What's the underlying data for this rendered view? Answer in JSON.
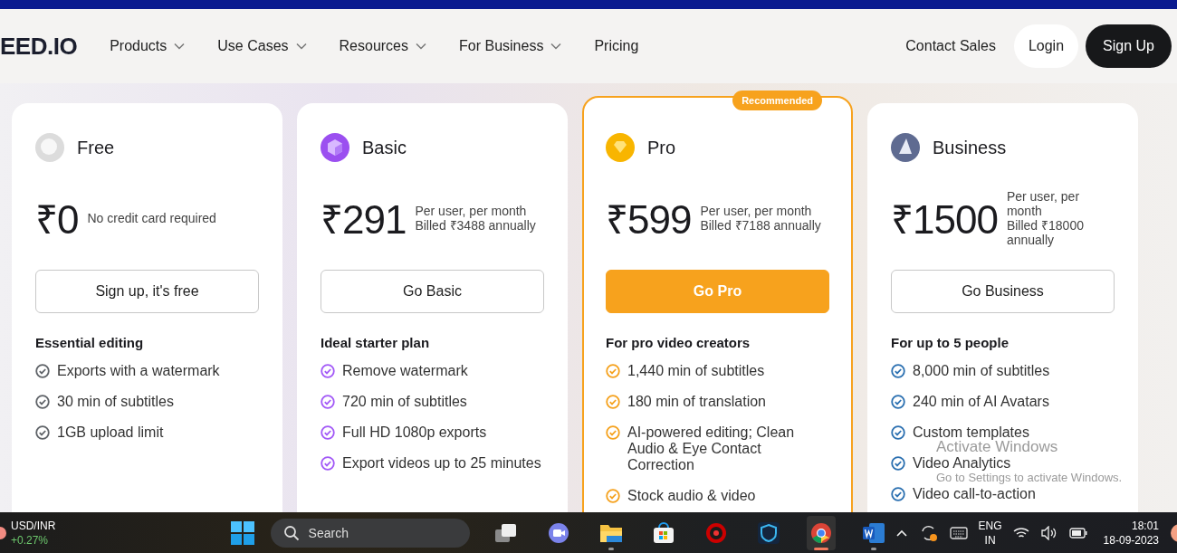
{
  "header": {
    "logo": "EED.IO",
    "nav": [
      {
        "label": "Products",
        "dropdown": true
      },
      {
        "label": "Use Cases",
        "dropdown": true
      },
      {
        "label": "Resources",
        "dropdown": true
      },
      {
        "label": "For Business",
        "dropdown": true
      },
      {
        "label": "Pricing",
        "dropdown": false
      }
    ],
    "contact": "Contact Sales",
    "login": "Login",
    "signup": "Sign Up"
  },
  "plans": [
    {
      "kind": "free",
      "name": "Free",
      "price": "₹0",
      "note": [
        "No credit card required"
      ],
      "button": "Sign up, it's free",
      "highlighted": false,
      "color": "#5f6368",
      "heading": "Essential editing",
      "features": [
        "Exports with a watermark",
        "30 min of subtitles",
        "1GB upload limit"
      ]
    },
    {
      "kind": "basic",
      "name": "Basic",
      "price": "₹291",
      "note": [
        "Per user, per month",
        "Billed ₹3488 annually"
      ],
      "button": "Go Basic",
      "highlighted": false,
      "color": "#a259f7",
      "heading": "Ideal starter plan",
      "features": [
        "Remove watermark",
        "720 min of subtitles",
        "Full HD 1080p exports",
        "Export videos up to 25 minutes"
      ]
    },
    {
      "kind": "pro",
      "name": "Pro",
      "badge": "Recommended",
      "price": "₹599",
      "note": [
        "Per user, per month",
        "Billed ₹7188 annually"
      ],
      "button": "Go Pro",
      "highlighted": true,
      "color": "#f5a11c",
      "heading": "For pro video creators",
      "features": [
        "1,440 min of subtitles",
        "180 min of translation",
        "AI-powered editing; Clean Audio & Eye Contact Correction",
        "Stock audio & video"
      ]
    },
    {
      "kind": "business",
      "name": "Business",
      "price": "₹1500",
      "note": [
        "Per user, per month",
        "Billed ₹18000 annually"
      ],
      "button": "Go Business",
      "highlighted": false,
      "color": "#2a6fb0",
      "heading": "For up to 5 people",
      "features": [
        "8,000 min of subtitles",
        "240 min of AI Avatars",
        "Custom templates",
        "Video Analytics",
        "Video call-to-action"
      ]
    }
  ],
  "activation": {
    "title": "Activate Windows",
    "hint": "Go to Settings to activate Windows."
  },
  "taskbar": {
    "ticker": {
      "pair": "USD/INR",
      "change": "+0.27%"
    },
    "search": {
      "placeholder": "Search"
    },
    "apps": [
      {
        "kind": "taskview",
        "running": false,
        "selected": false
      },
      {
        "kind": "meet",
        "running": false,
        "selected": false
      },
      {
        "kind": "folder",
        "running": true,
        "selected": false
      },
      {
        "kind": "store",
        "running": false,
        "selected": false
      },
      {
        "kind": "game",
        "running": false,
        "selected": false
      },
      {
        "kind": "shield",
        "running": false,
        "selected": false
      },
      {
        "kind": "chrome",
        "running": true,
        "selected": true
      },
      {
        "kind": "word",
        "running": true,
        "selected": false
      }
    ],
    "lang": [
      "ENG",
      "IN"
    ],
    "time": "18:01",
    "date": "18-09-2023"
  }
}
